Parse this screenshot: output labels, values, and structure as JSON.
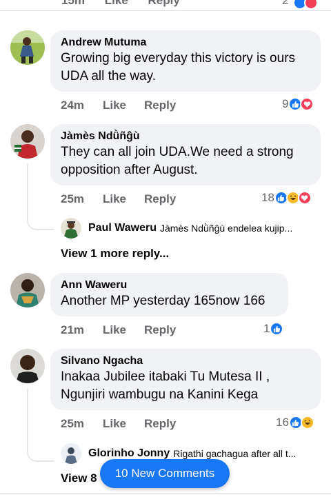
{
  "top_partial": {
    "time": "15m",
    "like": "Like",
    "reply": "Reply",
    "count": "2"
  },
  "comments": [
    {
      "name": "Andrew Mutuma",
      "text_line1": "Growing big everyday this victory is ours",
      "text_line2": "UDA all the way.",
      "time": "24m",
      "like": "Like",
      "reply": "Reply",
      "reaction_count": "9",
      "reactions": [
        "like-icon",
        "love-icon"
      ]
    },
    {
      "name": "Jàmès Ndǜñĝù",
      "text_line1": "They can all join UDA.We need a strong",
      "text_line2": "opposition after August.",
      "time": "25m",
      "like": "Like",
      "reply": "Reply",
      "reaction_count": "18",
      "reactions": [
        "like-icon",
        "haha-icon",
        "love-icon"
      ],
      "reply_preview": {
        "name": "Paul Waweru",
        "snippet": "Jàmès Ndǜñĝù endelea kujip..."
      },
      "view_more": "View 1 more reply..."
    },
    {
      "name": "Ann Waweru",
      "text_line1": "Another MP yesterday 165now 166",
      "time": "21m",
      "like": "Like",
      "reply": "Reply",
      "reaction_count": "1",
      "reactions": [
        "like-icon"
      ]
    },
    {
      "name": "Silvano Ngacha",
      "text_line1": "Inakaa Jubilee itabaki Tu Mutesa II ,",
      "text_line2": "Ngunjiri wambugu na Kanini Kega",
      "time": "25m",
      "like": "Like",
      "reply": "Reply",
      "reaction_count": "16",
      "reactions": [
        "like-icon",
        "haha-icon"
      ],
      "reply_preview": {
        "name": "Glorinho Jonny",
        "snippet": "Rigathi gachagua after all t..."
      },
      "view_more": "View 8"
    }
  ],
  "new_comments_button": "10 New Comments",
  "colors": {
    "accent": "#1877f2",
    "love": "#f33e58",
    "haha": "#f7b928",
    "bubble": "#f0f2f5",
    "meta": "#65676b"
  }
}
